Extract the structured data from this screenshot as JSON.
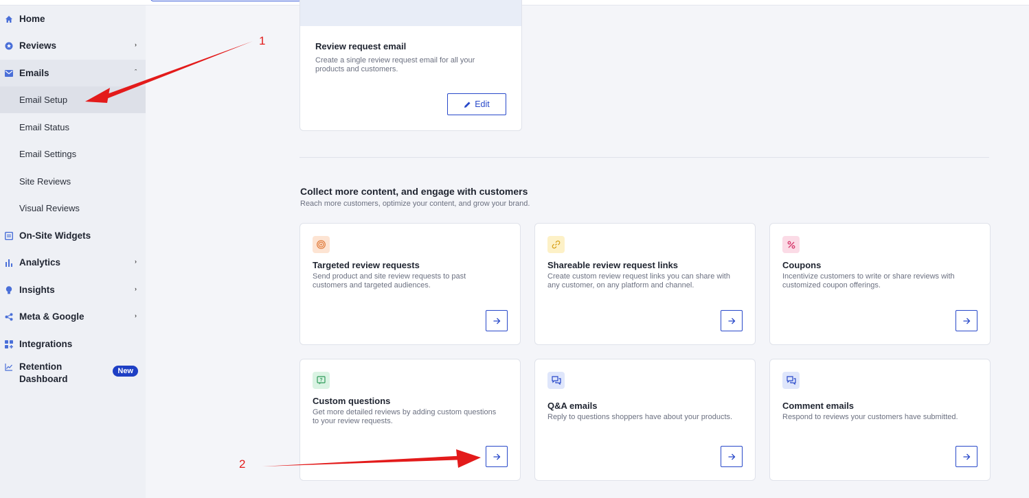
{
  "sidebar": {
    "items": [
      {
        "label": "Home",
        "icon": "home-icon"
      },
      {
        "label": "Reviews",
        "icon": "star-circle-icon"
      },
      {
        "label": "Emails",
        "icon": "mail-icon"
      },
      {
        "label": "On-Site Widgets",
        "icon": "widget-icon"
      },
      {
        "label": "Analytics",
        "icon": "bar-chart-icon"
      },
      {
        "label": "Insights",
        "icon": "lightbulb-icon"
      },
      {
        "label": "Meta & Google",
        "icon": "share-icon"
      },
      {
        "label": "Integrations",
        "icon": "grid-plus-icon"
      },
      {
        "label": "Retention",
        "label2": "Dashboard",
        "icon": "trend-icon",
        "badge": "New"
      }
    ],
    "email_subitems": [
      "Email Setup",
      "Email Status",
      "Email Settings",
      "Site Reviews",
      "Visual Reviews"
    ]
  },
  "review_request": {
    "title": "Review request email",
    "desc1": "Create a single review request email for all your",
    "desc2": "products and customers.",
    "edit_label": "Edit"
  },
  "section": {
    "title": "Collect more content, and engage with customers",
    "subtitle": "Reach more customers, optimize your content, and grow your brand."
  },
  "cards": [
    {
      "title": "Targeted review requests",
      "desc1": "Send product and site review requests to past",
      "desc2": "customers and targeted audiences."
    },
    {
      "title": "Shareable review request links",
      "desc1": "Create custom review request links you can share with",
      "desc2": "any customer, on any platform and channel."
    },
    {
      "title": "Coupons",
      "desc1": "Incentivize customers to write or share reviews with",
      "desc2": "customized coupon offerings."
    },
    {
      "title": "Custom questions",
      "desc1": "Get more detailed reviews by adding custom questions",
      "desc2": "to your review requests."
    },
    {
      "title": "Q&A emails",
      "desc1": "Reply to questions shoppers have about your products.",
      "desc2": ""
    },
    {
      "title": "Comment emails",
      "desc1": "Respond to reviews your customers have submitted.",
      "desc2": ""
    }
  ],
  "annotations": {
    "one": "1",
    "two": "2"
  },
  "colors": {
    "accent": "#2748c9",
    "annotation": "#e31b1b"
  }
}
